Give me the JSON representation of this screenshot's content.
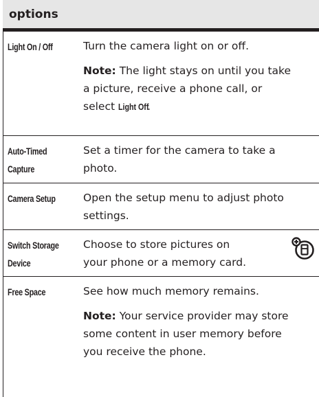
{
  "header": {
    "label": "options"
  },
  "rows": [
    {
      "option": "Light On / Off",
      "description": "Turn the camera light on or off.",
      "note": {
        "label": "Note:",
        "line1": "The light stays on until you take",
        "line2": "a picture, receive a phone call, or",
        "line3_pre": "select",
        "line3_cmd": "Light Off",
        "line3_post": "."
      }
    },
    {
      "option_line1": "Auto-Timed",
      "option_line2": "Capture",
      "desc_line1": "Set a timer for the camera to take a",
      "desc_line2": "photo."
    },
    {
      "option": "Camera Setup",
      "desc_line1": "Open the setup menu to adjust photo",
      "desc_line2": "settings."
    },
    {
      "option_line1": "Switch Storage",
      "option_line2": "Device",
      "desc_line1": "Choose to store pictures on",
      "desc_line2": "your phone or a memory card.",
      "icon": "memory-card-storage-icon"
    },
    {
      "option": "Free Space",
      "description": "See how much memory remains.",
      "note": {
        "label": "Note:",
        "line1": "Your service provider may store",
        "line2": "some content in user memory before",
        "line3": "you receive the phone."
      }
    }
  ]
}
